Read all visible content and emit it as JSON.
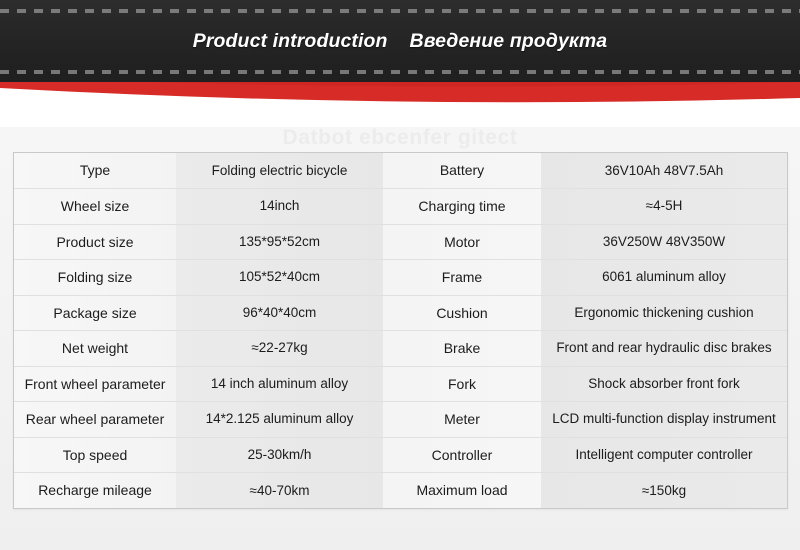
{
  "header": {
    "title_en": "Product introduction",
    "title_ru": "Введение продукта"
  },
  "watermark": "Datbot ebcenfer gitect",
  "table": {
    "rows": [
      {
        "left_label": "Type",
        "left_value": "Folding electric bicycle",
        "right_label": "Battery",
        "right_value": "36V10Ah    48V7.5Ah"
      },
      {
        "left_label": "Wheel size",
        "left_value": "14inch",
        "right_label": "Charging time",
        "right_value": "≈4-5H"
      },
      {
        "left_label": "Product size",
        "left_value": "135*95*52cm",
        "right_label": "Motor",
        "right_value": "36V250W    48V350W"
      },
      {
        "left_label": "Folding size",
        "left_value": "105*52*40cm",
        "right_label": "Frame",
        "right_value": "6061 aluminum alloy"
      },
      {
        "left_label": "Package size",
        "left_value": "96*40*40cm",
        "right_label": "Cushion",
        "right_value": "Ergonomic thickening cushion"
      },
      {
        "left_label": "Net weight",
        "left_value": "≈22-27kg",
        "right_label": "Brake",
        "right_value": "Front and rear hydraulic disc brakes"
      },
      {
        "left_label": "Front wheel parameter",
        "left_value": "14 inch aluminum alloy",
        "right_label": "Fork",
        "right_value": "Shock absorber front fork"
      },
      {
        "left_label": "Rear wheel parameter",
        "left_value": "14*2.125 aluminum alloy",
        "right_label": "Meter",
        "right_value": "LCD multi-function display instrument"
      },
      {
        "left_label": "Top speed",
        "left_value": "25-30km/h",
        "right_label": "Controller",
        "right_value": "Intelligent computer controller"
      },
      {
        "left_label": "Recharge mileage",
        "left_value": "≈40-70km",
        "right_label": "Maximum load",
        "right_value": "≈150kg"
      }
    ]
  },
  "colors": {
    "banner_dark": "#242424",
    "ribbon_red": "#d62b26",
    "page_bg": "#f4f4f4",
    "label_cell": "#f5f5f5",
    "value_cell": "#e8e8e8"
  }
}
